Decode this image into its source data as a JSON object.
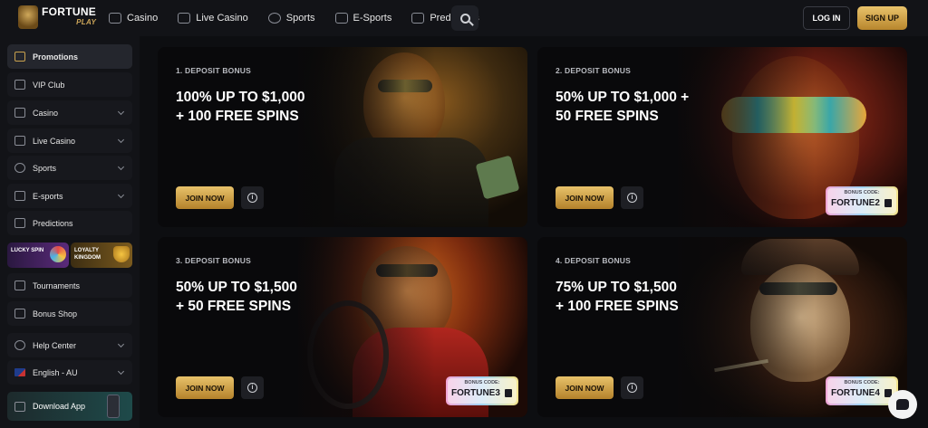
{
  "brand": {
    "name": "FORTUNE",
    "tagline": "PLAY"
  },
  "nav": [
    {
      "label": "Casino",
      "icon": "slot-machine-icon"
    },
    {
      "label": "Live Casino",
      "icon": "dealer-icon"
    },
    {
      "label": "Sports",
      "icon": "soccer-ball-icon"
    },
    {
      "label": "E-Sports",
      "icon": "gamepad-icon"
    },
    {
      "label": "Predictions",
      "icon": "chart-icon"
    }
  ],
  "auth": {
    "login": "LOG IN",
    "signup": "SIGN UP"
  },
  "sidebar": {
    "items": [
      {
        "label": "Promotions",
        "icon": "gift-icon"
      },
      {
        "label": "VIP Club",
        "icon": "crown-icon"
      },
      {
        "label": "Casino",
        "icon": "slot-machine-icon"
      },
      {
        "label": "Live Casino",
        "icon": "dealer-icon"
      },
      {
        "label": "Sports",
        "icon": "soccer-ball-icon"
      },
      {
        "label": "E-sports",
        "icon": "gamepad-icon"
      },
      {
        "label": "Predictions",
        "icon": "chart-icon"
      },
      {
        "label": "Tournaments",
        "icon": "trophy-icon"
      },
      {
        "label": "Bonus Shop",
        "icon": "shopping-bag-icon"
      },
      {
        "label": "Help Center",
        "icon": "help-icon"
      },
      {
        "label": "English - AU",
        "icon": "australia-flag-icon"
      },
      {
        "label": "Download App",
        "icon": "download-icon"
      }
    ],
    "promos": {
      "lucky_spin": "LUCKY SPIN",
      "loyalty": [
        "LOYALTY",
        "KINGDOM"
      ]
    }
  },
  "cards": [
    {
      "label": "1. DEPOSIT BONUS",
      "line1": "100% UP TO $1,000",
      "line2": "+ 100 FREE SPINS",
      "join": "JOIN NOW",
      "code": ""
    },
    {
      "label": "2. DEPOSIT BONUS",
      "line1": "50% UP TO $1,000 +",
      "line2": "50 FREE SPINS",
      "join": "JOIN NOW",
      "code": "FORTUNE2"
    },
    {
      "label": "3. DEPOSIT BONUS",
      "line1": "50% UP TO $1,500",
      "line2": "+ 50 FREE SPINS",
      "join": "JOIN NOW",
      "code": "FORTUNE3"
    },
    {
      "label": "4. DEPOSIT BONUS",
      "line1": "75% UP TO $1,500",
      "line2": "+ 100 FREE SPINS",
      "join": "JOIN NOW",
      "code": "FORTUNE4"
    }
  ],
  "bonus_code_caption": "BONUS CODE:",
  "info_glyph": "i",
  "colors": {
    "accent_gold": "#e0b55a",
    "background": "#0d0e11",
    "panel": "#121317"
  }
}
